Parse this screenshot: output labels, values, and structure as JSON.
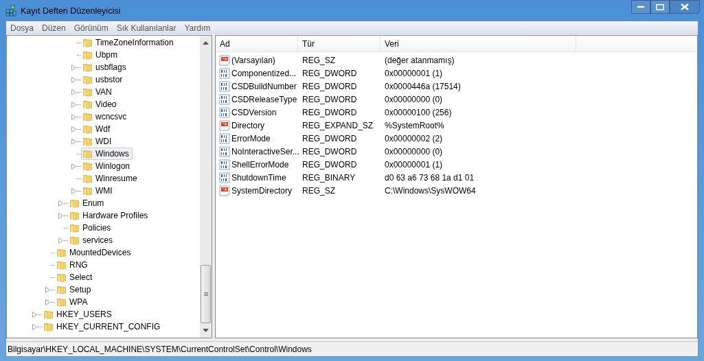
{
  "window": {
    "title": "Kayıt Defteri Düzenleyicisi"
  },
  "menu": [
    "Dosya",
    "Düzen",
    "Görünüm",
    "Sık Kullanılanlar",
    "Yardım"
  ],
  "tree": [
    {
      "children": [
        {
          "children": [
            {
              "children": [
                {
                  "label": "TimeZoneInformation",
                  "expandable": false,
                  "selected": false
                },
                {
                  "label": "Ubpm",
                  "expandable": false,
                  "selected": false
                },
                {
                  "label": "usbflags",
                  "expandable": true,
                  "selected": false
                },
                {
                  "label": "usbstor",
                  "expandable": true,
                  "selected": false
                },
                {
                  "label": "VAN",
                  "expandable": true,
                  "selected": false
                },
                {
                  "label": "Video",
                  "expandable": true,
                  "selected": false
                },
                {
                  "label": "wcncsvc",
                  "expandable": true,
                  "selected": false
                },
                {
                  "label": "Wdf",
                  "expandable": true,
                  "selected": false
                },
                {
                  "label": "WDI",
                  "expandable": true,
                  "selected": false
                },
                {
                  "label": "Windows",
                  "expandable": false,
                  "selected": true
                },
                {
                  "label": "Winlogon",
                  "expandable": true,
                  "selected": false
                },
                {
                  "label": "Winresume",
                  "expandable": false,
                  "selected": false
                },
                {
                  "label": "WMI",
                  "expandable": true,
                  "selected": false
                }
              ]
            },
            {
              "label": "Enum",
              "expandable": true,
              "selected": false
            },
            {
              "label": "Hardware Profiles",
              "expandable": true,
              "selected": false
            },
            {
              "label": "Policies",
              "expandable": false,
              "selected": false
            },
            {
              "label": "services",
              "expandable": true,
              "selected": false
            }
          ]
        },
        {
          "label": "MountedDevices",
          "expandable": false,
          "selected": false
        },
        {
          "label": "RNG",
          "expandable": false,
          "selected": false
        },
        {
          "label": "Select",
          "expandable": false,
          "selected": false
        },
        {
          "label": "Setup",
          "expandable": true,
          "selected": false
        },
        {
          "label": "WPA",
          "expandable": true,
          "selected": false
        }
      ]
    },
    {
      "label": "HKEY_USERS",
      "expandable": true,
      "selected": false
    },
    {
      "label": "HKEY_CURRENT_CONFIG",
      "expandable": true,
      "selected": false
    }
  ],
  "table": {
    "columns": [
      "Ad",
      "Tür",
      "Veri"
    ],
    "rows": [
      {
        "kind": "string",
        "name": "(Varsayılan)",
        "type": "REG_SZ",
        "data": "(değer atanmamış)"
      },
      {
        "kind": "binary",
        "name": "Componentized...",
        "type": "REG_DWORD",
        "data": "0x00000001 (1)"
      },
      {
        "kind": "binary",
        "name": "CSDBuildNumber",
        "type": "REG_DWORD",
        "data": "0x0000446a (17514)"
      },
      {
        "kind": "binary",
        "name": "CSDReleaseType",
        "type": "REG_DWORD",
        "data": "0x00000000 (0)"
      },
      {
        "kind": "binary",
        "name": "CSDVersion",
        "type": "REG_DWORD",
        "data": "0x00000100 (256)"
      },
      {
        "kind": "string",
        "name": "Directory",
        "type": "REG_EXPAND_SZ",
        "data": "%SystemRoot%"
      },
      {
        "kind": "binary",
        "name": "ErrorMode",
        "type": "REG_DWORD",
        "data": "0x00000002 (2)"
      },
      {
        "kind": "binary",
        "name": "NoInteractiveSer...",
        "type": "REG_DWORD",
        "data": "0x00000000 (0)"
      },
      {
        "kind": "binary",
        "name": "ShellErrorMode",
        "type": "REG_DWORD",
        "data": "0x00000001 (1)"
      },
      {
        "kind": "binary",
        "name": "ShutdownTime",
        "type": "REG_BINARY",
        "data": "d0 63 a6 73 68 1a d1 01"
      },
      {
        "kind": "string",
        "name": "SystemDirectory",
        "type": "REG_SZ",
        "data": "C:\\Windows\\SysWOW64"
      }
    ]
  },
  "status_bar": "Bilgisayar\\HKEY_LOCAL_MACHINE\\SYSTEM\\CurrentControlSet\\Control\\Windows"
}
